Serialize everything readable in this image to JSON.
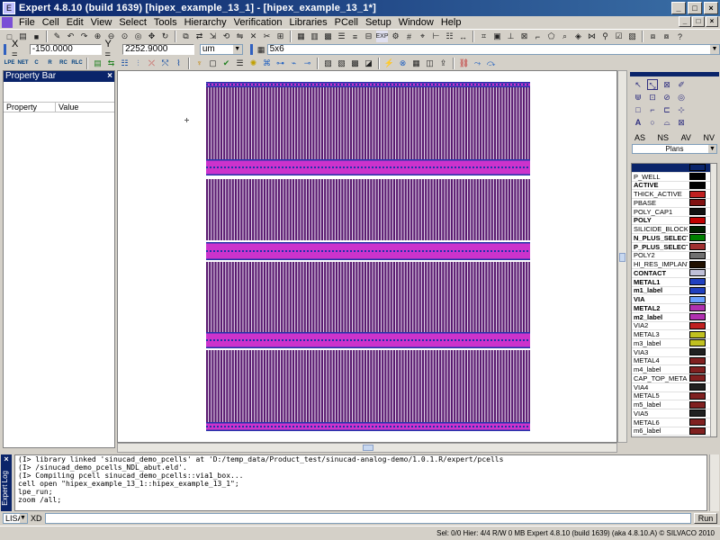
{
  "window": {
    "title": "Expert 4.8.10 (build 1639) [hipex_example_13_1] - [hipex_example_13_1*]",
    "controls": [
      "_",
      "□",
      "×"
    ]
  },
  "menubar": {
    "items": [
      "File",
      "Cell",
      "Edit",
      "View",
      "Select",
      "Tools",
      "Hierarchy",
      "Verification",
      "Libraries",
      "PCell",
      "Setup",
      "Window",
      "Help"
    ],
    "mdi_controls": [
      "_",
      "□",
      "×"
    ]
  },
  "coords": {
    "x_label": "X =",
    "x_value": "-150.0000",
    "y_label": "Y =",
    "y_value": "2252.9000",
    "units": "um",
    "stepping": "5x6"
  },
  "toolbar2": {
    "labels": [
      "LPE",
      "NET",
      "C",
      "R",
      "RC",
      "RLC"
    ]
  },
  "property_bar": {
    "title": "Property Bar",
    "close": "×",
    "col_property": "Property",
    "col_value": "Value"
  },
  "layer_panel": {
    "tabs": [
      "AS",
      "NS",
      "AV",
      "NV"
    ],
    "plans": "Plans",
    "layers": [
      {
        "name": "",
        "color": "#0a246a",
        "bold": false,
        "selected": true
      },
      {
        "name": "P_WELL",
        "color": "#000000",
        "bold": false
      },
      {
        "name": "ACTIVE",
        "color": "#000000",
        "bold": true
      },
      {
        "name": "THICK_ACTIVE",
        "color": "#c02020",
        "bold": false
      },
      {
        "name": "PBASE",
        "color": "#801010",
        "bold": false
      },
      {
        "name": "POLY_CAP1",
        "color": "#101010",
        "bold": false
      },
      {
        "name": "POLY",
        "color": "#c00000",
        "bold": true
      },
      {
        "name": "SILICIDE_BLOCK",
        "color": "#002000",
        "bold": false
      },
      {
        "name": "N_PLUS_SELECT",
        "color": "#008000",
        "bold": true
      },
      {
        "name": "P_PLUS_SELECT",
        "color": "#a03030",
        "bold": true
      },
      {
        "name": "POLY2",
        "color": "#707070",
        "bold": false
      },
      {
        "name": "HI_RES_IMPLANT",
        "color": "#201000",
        "bold": false
      },
      {
        "name": "CONTACT",
        "color": "#c0c0d8",
        "bold": true
      },
      {
        "name": "METAL1",
        "color": "#2040c0",
        "bold": true
      },
      {
        "name": "m1_label",
        "color": "#2040c0",
        "bold": true
      },
      {
        "name": "VIA",
        "color": "#6aa0ff",
        "bold": true
      },
      {
        "name": "METAL2",
        "color": "#b030b0",
        "bold": true
      },
      {
        "name": "m2_label",
        "color": "#b030b0",
        "bold": true
      },
      {
        "name": "VIA2",
        "color": "#c02020",
        "bold": false
      },
      {
        "name": "METAL3",
        "color": "#c0c020",
        "bold": false
      },
      {
        "name": "m3_label",
        "color": "#c0c020",
        "bold": false
      },
      {
        "name": "VIA3",
        "color": "#202020",
        "bold": false
      },
      {
        "name": "METAL4",
        "color": "#802020",
        "bold": false
      },
      {
        "name": "m4_label",
        "color": "#802020",
        "bold": false
      },
      {
        "name": "CAP_TOP_METAL",
        "color": "#802020",
        "bold": false
      },
      {
        "name": "VIA4",
        "color": "#202020",
        "bold": false
      },
      {
        "name": "METAL5",
        "color": "#802020",
        "bold": false
      },
      {
        "name": "m5_label",
        "color": "#802020",
        "bold": false
      },
      {
        "name": "VIA5",
        "color": "#202020",
        "bold": false
      },
      {
        "name": "METAL6",
        "color": "#802020",
        "bold": false
      },
      {
        "name": "m6_label",
        "color": "#802020",
        "bold": false
      }
    ]
  },
  "log": {
    "side_label": "Expert Log",
    "close": "×",
    "lines": [
      "(I> library linked 'sinucad_demo_pcells' at 'D:/temp_data/Product_test/sinucad-analog-demo/1.0.1.R/expert/pcells",
      "(I> /sinucad_demo_pcells_NDL_abut.eld'.",
      "(I> Compiling pcell sinucad_demo_pcells::via1_box...",
      "cell open \"hipex_example_13_1::hipex_example_13_1\";",
      "lpe_run;",
      "zoom /all;"
    ]
  },
  "command": {
    "language": "LISA",
    "xd": "XD",
    "run": "Run"
  },
  "status": {
    "text": "Sel: 0/0  Hier: 4/4  R/W 0 MB  Expert 4.8.10 (build 1639) (aka 4.8.10.A) © SILVACO 2010"
  },
  "colors": {
    "device_purple": "#5a1a70",
    "poly_magenta": "#cc33cc",
    "metal_blue": "#2233aa",
    "title_blue": "#0a246a"
  }
}
